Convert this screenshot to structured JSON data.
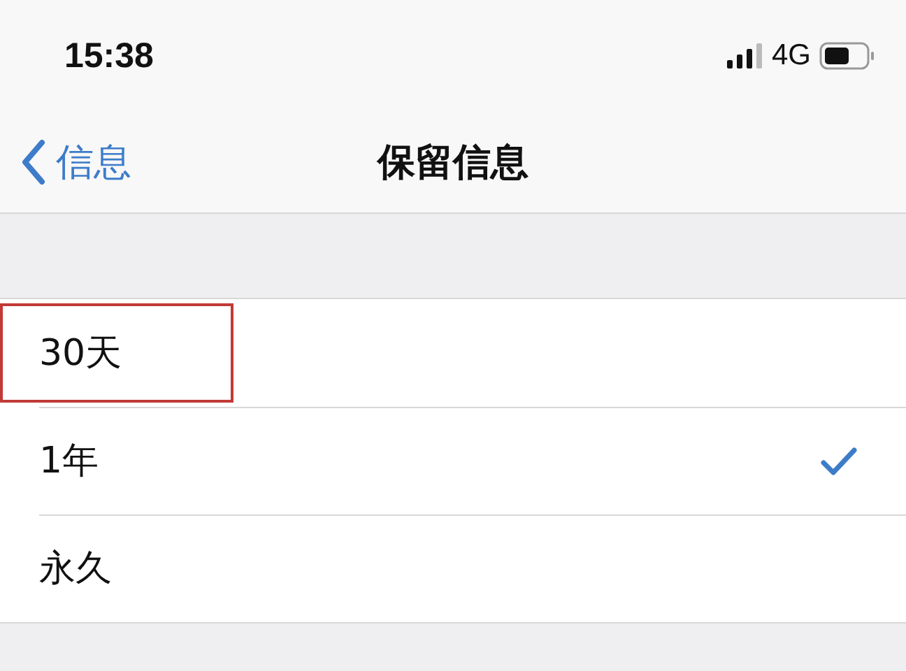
{
  "status_bar": {
    "time": "15:38",
    "network": "4G"
  },
  "nav_bar": {
    "back": "信息",
    "title": "保留信息"
  },
  "options": [
    {
      "label": "30天",
      "selected": false,
      "highlighted": true
    },
    {
      "label": "1年",
      "selected": true,
      "highlighted": false
    },
    {
      "label": "永久",
      "selected": false,
      "highlighted": false
    }
  ]
}
